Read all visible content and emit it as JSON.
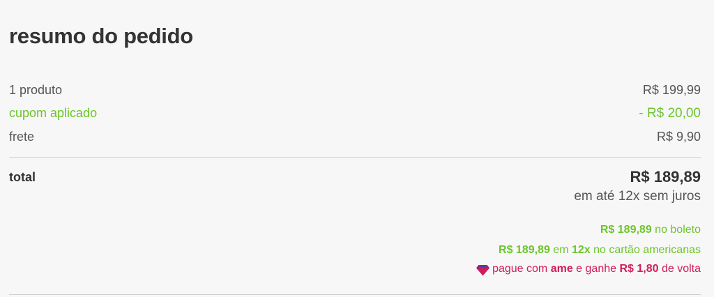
{
  "summary": {
    "title": "resumo do pedido",
    "products_label": "1 produto",
    "products_value": "R$ 199,99",
    "coupon_label": "cupom aplicado",
    "coupon_value": "- R$ 20,00",
    "shipping_label": "frete",
    "shipping_value": "R$ 9,90",
    "total_label": "total",
    "total_value": "R$ 189,89",
    "installments_text": "em até 12x sem juros"
  },
  "offers": {
    "boleto_price": "R$ 189,89",
    "boleto_text": " no boleto",
    "card_price": "R$ 189,89",
    "card_mid": " em ",
    "card_installments": "12x",
    "card_text": " no cartão americanas",
    "ame_prefix": "pague com ",
    "ame_brand": "ame",
    "ame_mid": " e ganhe ",
    "ame_cashback": "R$ 1,80",
    "ame_suffix": " de volta"
  },
  "colors": {
    "green": "#6cc52a",
    "pink": "#d01c5b",
    "text_dark": "#333333",
    "text": "#555555",
    "background": "#f7f7f7"
  },
  "icons": {
    "ame": "ame-heart-icon"
  }
}
